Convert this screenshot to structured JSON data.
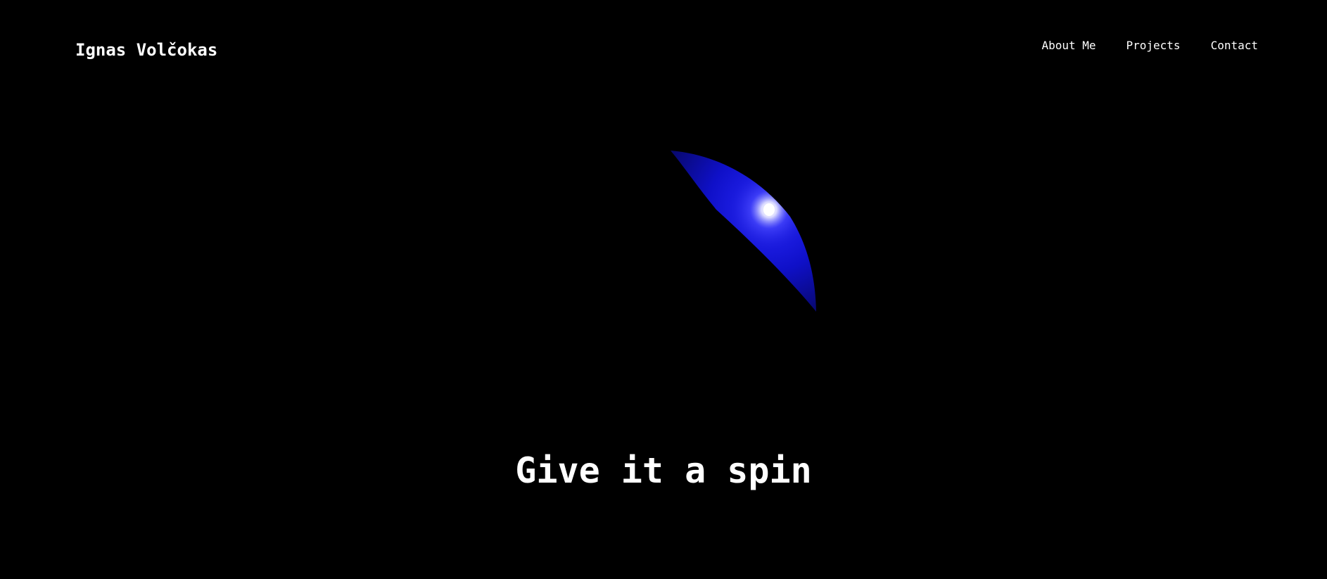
{
  "header": {
    "brand": "Ignas Volčokas",
    "nav": [
      {
        "label": "About Me"
      },
      {
        "label": "Projects"
      },
      {
        "label": "Contact"
      }
    ]
  },
  "hero": {
    "headline": "Give it a spin",
    "sphere_color": "#1111c8",
    "highlight_color": "#ffffff"
  },
  "colors": {
    "background": "#000000",
    "text": "#ffffff"
  }
}
